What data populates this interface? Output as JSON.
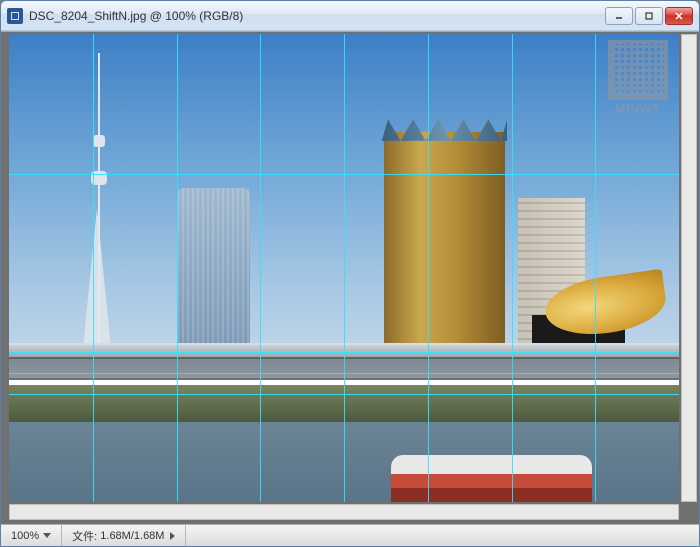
{
  "window": {
    "title": "DSC_8204_ShiftN.jpg @ 100% (RGB/8)"
  },
  "statusbar": {
    "zoom": "100%",
    "doc_label": "文件:",
    "doc_sizes": "1.68M/1.68M"
  },
  "watermark": {
    "text": "MINWT"
  },
  "grid": {
    "vertical_pct": [
      12.5,
      25,
      37.5,
      50,
      62.5,
      75,
      87.5
    ],
    "horizontal_pct": [
      30,
      68,
      72.5,
      77
    ]
  },
  "colors": {
    "guide": "#33e0ff",
    "titlebar_text": "#333333"
  }
}
